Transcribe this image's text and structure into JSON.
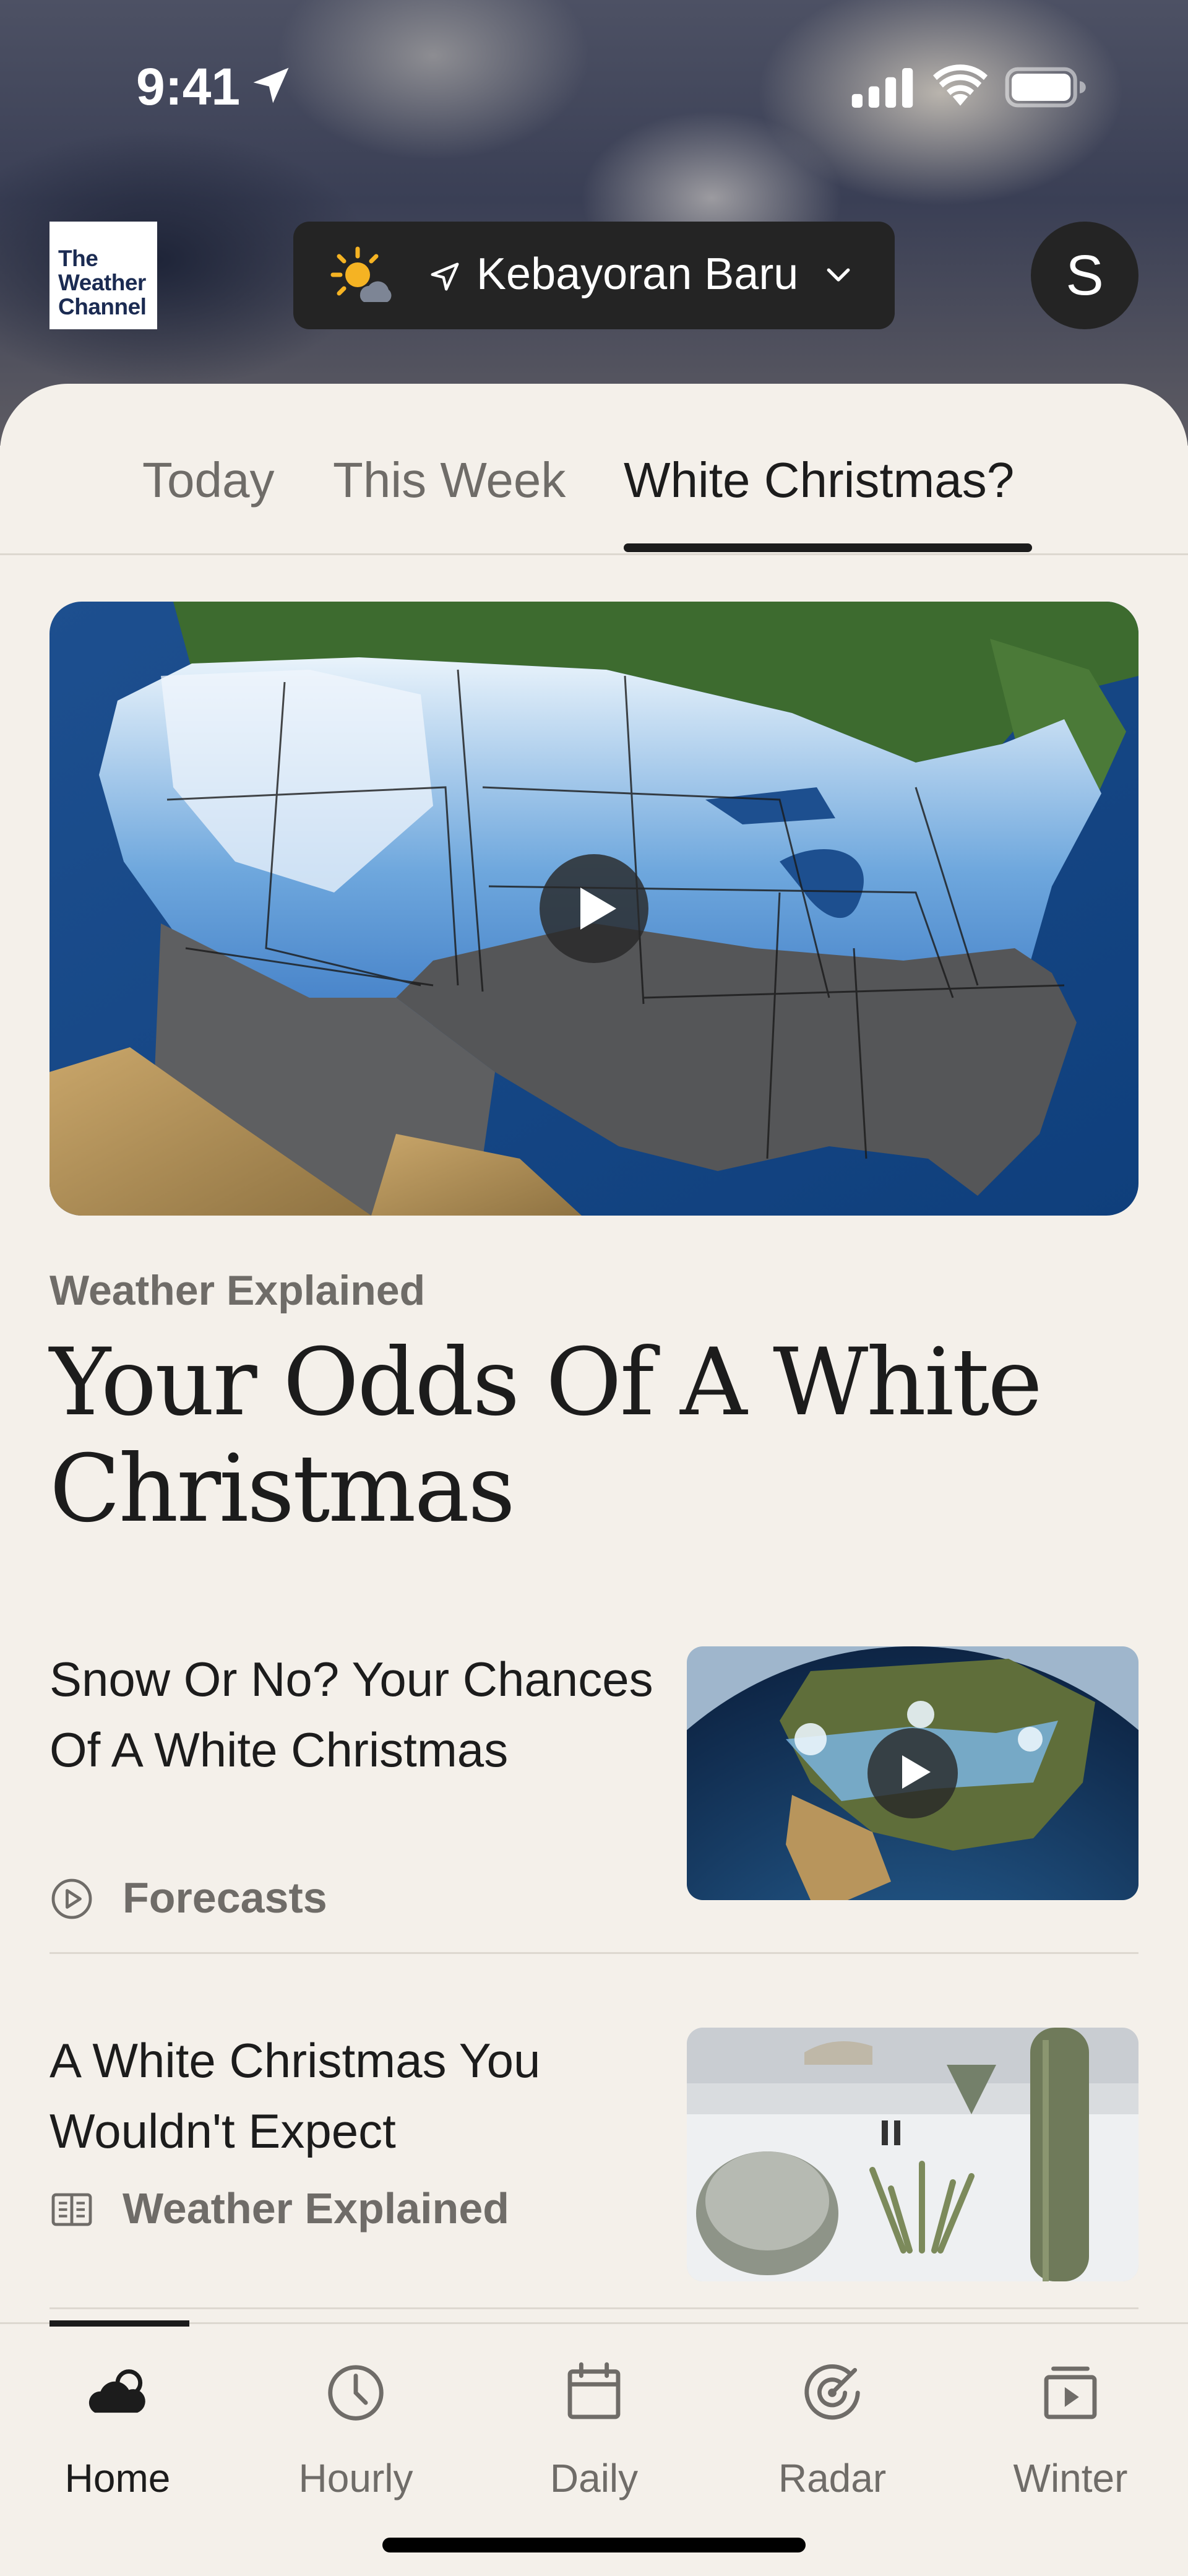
{
  "status_bar": {
    "time": "9:41"
  },
  "header": {
    "logo_lines": [
      "The",
      "Weather",
      "Channel"
    ],
    "location": "Kebayoran Baru",
    "avatar_initial": "S"
  },
  "tabs": [
    {
      "label": "Today",
      "active": false
    },
    {
      "label": "This Week",
      "active": false
    },
    {
      "label": "White Christmas?",
      "active": true
    }
  ],
  "featured": {
    "kicker": "Weather Explained",
    "title": "Your Odds Of A White Christmas"
  },
  "stories": [
    {
      "title": "Snow Or No? Your Chances Of A White Christmas",
      "category": "Forecasts",
      "category_icon": "play-circle-icon"
    },
    {
      "title": "A White Christmas You Wouldn't Expect",
      "category": "Weather Explained",
      "category_icon": "article-icon"
    }
  ],
  "bottom_nav": [
    {
      "label": "Home",
      "icon": "cloud-sun-icon",
      "active": true
    },
    {
      "label": "Hourly",
      "icon": "clock-icon",
      "active": false
    },
    {
      "label": "Daily",
      "icon": "calendar-icon",
      "active": false
    },
    {
      "label": "Radar",
      "icon": "radar-icon",
      "active": false
    },
    {
      "label": "Winter",
      "icon": "video-icon",
      "active": false
    }
  ],
  "colors": {
    "background": "#f4f0ea",
    "text": "#1c1c1c",
    "muted": "#6f6c68",
    "pill": "#242424"
  }
}
